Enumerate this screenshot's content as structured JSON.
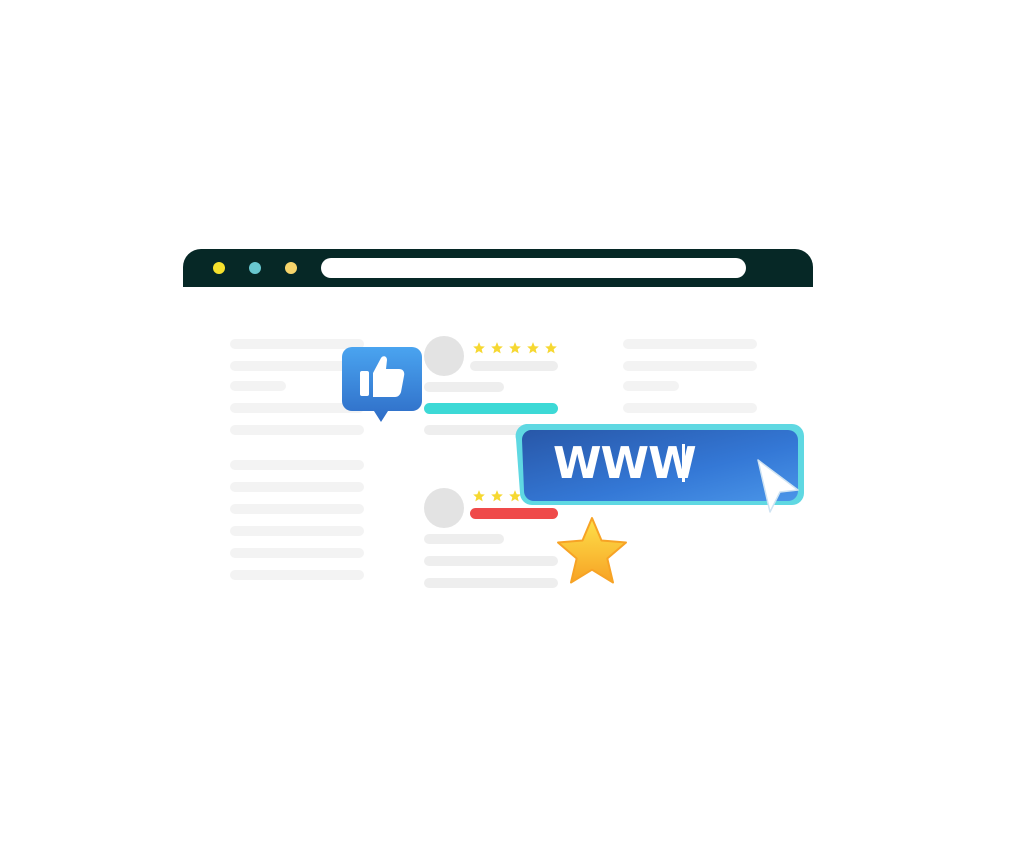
{
  "url_box": {
    "text": "WWW"
  },
  "reviews": [
    {
      "stars": 5,
      "accent_color": "#3dd9d6"
    },
    {
      "stars": 3,
      "accent_color": "#ef4a4a"
    }
  ],
  "colors": {
    "chrome": "#062826",
    "dot_1": "#f6e12d",
    "dot_2": "#68c7cf",
    "dot_3": "#f7d56b",
    "star": "#f6d832",
    "url_box_border": "#5fd8e2",
    "url_box_fill": "#2f6fc9"
  },
  "icons": [
    "thumbs-up-icon",
    "star-icon",
    "cursor-icon"
  ]
}
